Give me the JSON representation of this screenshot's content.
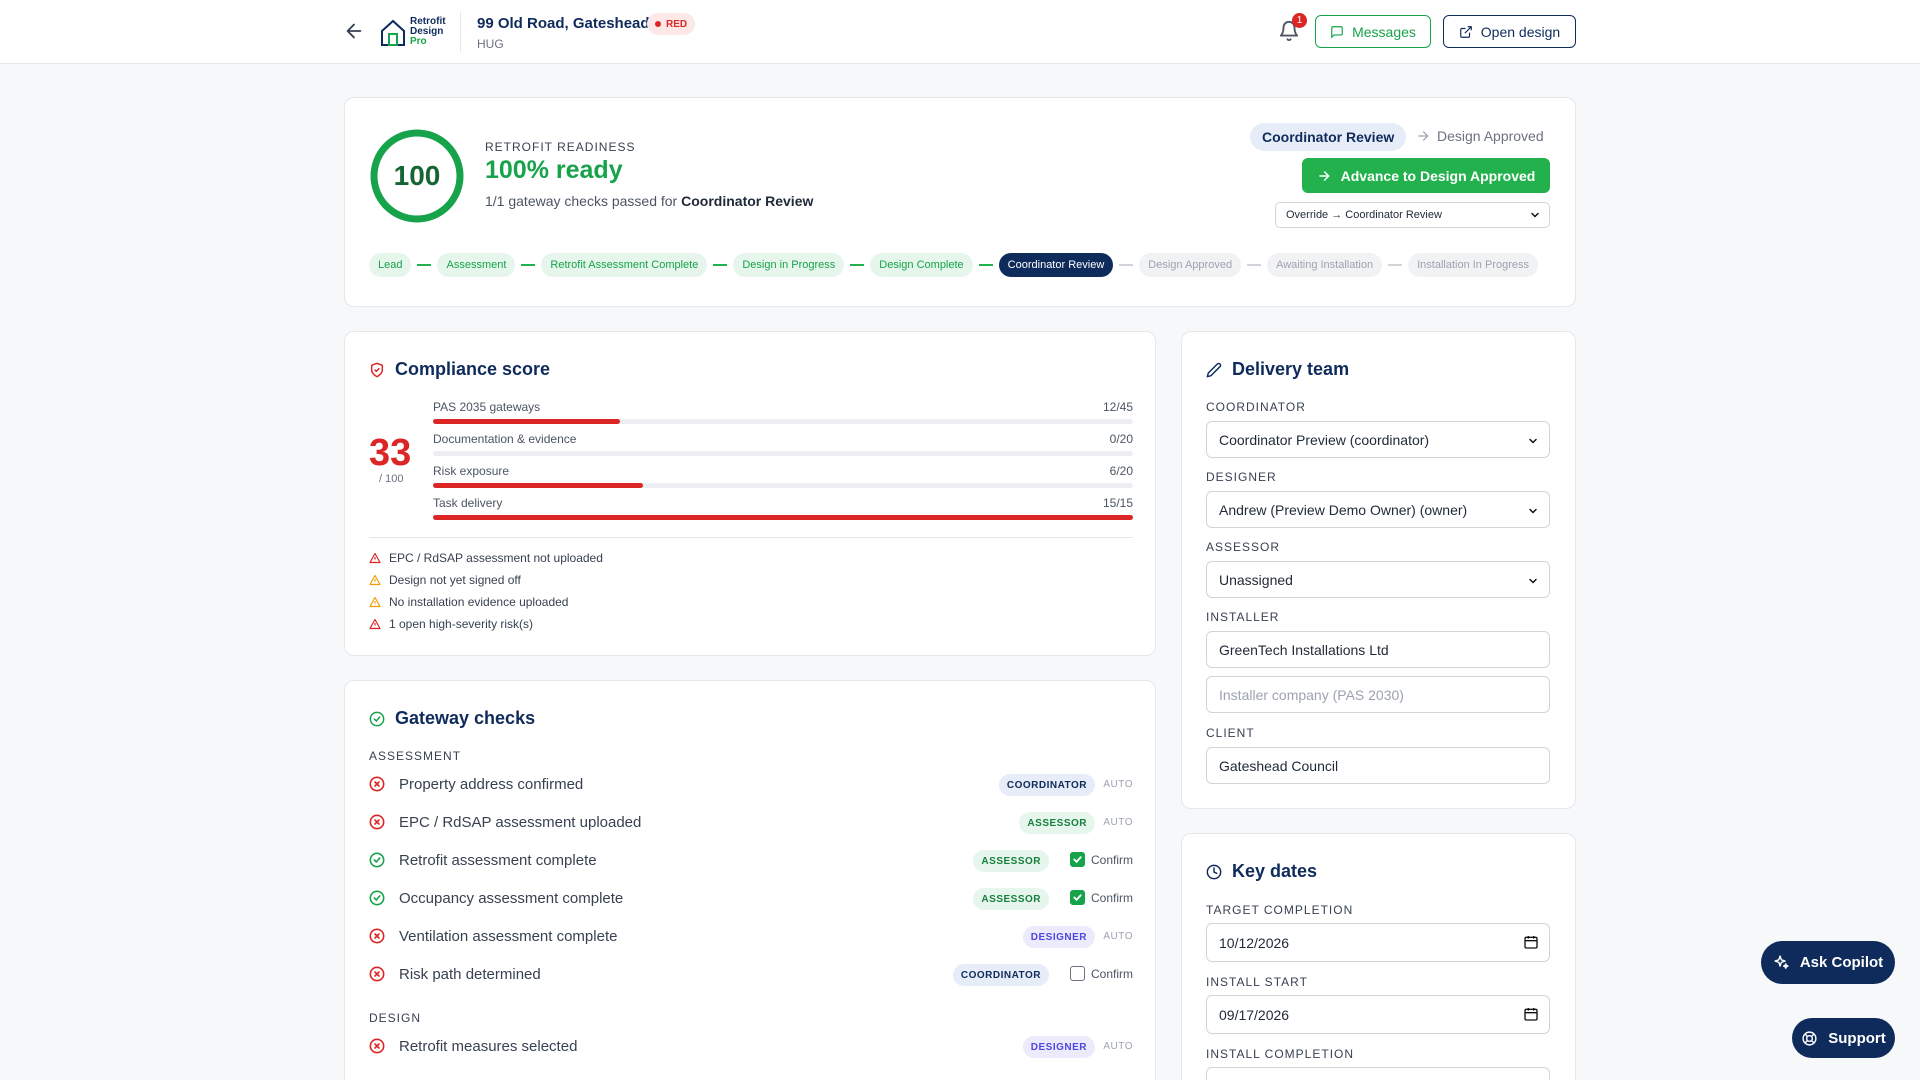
{
  "header": {
    "logo": {
      "line1": "Retrofit",
      "line2": "Design",
      "line3": "Pro"
    },
    "property_title": "99 Old Road, Gateshead",
    "property_sub": "HUG",
    "rag_label": "RED",
    "notification_count": "1",
    "messages_label": "Messages",
    "open_design_label": "Open design"
  },
  "readiness": {
    "score": "100",
    "score_fraction": 1.0,
    "eyebrow": "RETROFIT READINESS",
    "title": "100% ready",
    "sub_prefix": "1/1 gateway checks passed for",
    "sub_stage": "Coordinator Review",
    "current_stage": "Coordinator Review",
    "next_stage": "Design Approved",
    "advance_label": "Advance to Design Approved",
    "override_value": "Override → Coordinator Review",
    "pipeline": [
      {
        "label": "Lead",
        "state": "done"
      },
      {
        "label": "Assessment",
        "state": "done"
      },
      {
        "label": "Retrofit Assessment Complete",
        "state": "done"
      },
      {
        "label": "Design in Progress",
        "state": "done"
      },
      {
        "label": "Design Complete",
        "state": "done"
      },
      {
        "label": "Coordinator Review",
        "state": "current"
      },
      {
        "label": "Design Approved",
        "state": "future"
      },
      {
        "label": "Awaiting Installation",
        "state": "future"
      },
      {
        "label": "Installation In Progress",
        "state": "future"
      }
    ]
  },
  "compliance": {
    "title": "Compliance score",
    "score": "33",
    "denominator": "/ 100",
    "metrics": [
      {
        "label": "PAS 2035 gateways",
        "value": "12/45",
        "fraction": 0.267
      },
      {
        "label": "Documentation & evidence",
        "value": "0/20",
        "fraction": 0
      },
      {
        "label": "Risk exposure",
        "value": "6/20",
        "fraction": 0.3
      },
      {
        "label": "Task delivery",
        "value": "15/15",
        "fraction": 1.0
      }
    ],
    "issues": [
      {
        "text": "EPC / RdSAP assessment not uploaded",
        "severity": "high"
      },
      {
        "text": "Design not yet signed off",
        "severity": "medium"
      },
      {
        "text": "No installation evidence uploaded",
        "severity": "medium"
      },
      {
        "text": "1 open high-severity risk(s)",
        "severity": "high"
      }
    ]
  },
  "gateway": {
    "title": "Gateway checks",
    "sections": [
      {
        "label": "ASSESSMENT",
        "checks": [
          {
            "label": "Property address confirmed",
            "status": "fail",
            "role": "COORDINATOR",
            "mode": "AUTO"
          },
          {
            "label": "EPC / RdSAP assessment uploaded",
            "status": "fail",
            "role": "ASSESSOR",
            "mode": "AUTO"
          },
          {
            "label": "Retrofit assessment complete",
            "status": "pass",
            "role": "ASSESSOR",
            "mode": "Confirm",
            "checked": true
          },
          {
            "label": "Occupancy assessment complete",
            "status": "pass",
            "role": "ASSESSOR",
            "mode": "Confirm",
            "checked": true
          },
          {
            "label": "Ventilation assessment complete",
            "status": "fail",
            "role": "DESIGNER",
            "mode": "AUTO"
          },
          {
            "label": "Risk path determined",
            "status": "fail",
            "role": "COORDINATOR",
            "mode": "Confirm",
            "checked": false
          }
        ]
      },
      {
        "label": "DESIGN",
        "checks": [
          {
            "label": "Retrofit measures selected",
            "status": "fail",
            "role": "DESIGNER",
            "mode": "AUTO"
          }
        ]
      }
    ]
  },
  "team": {
    "title": "Delivery team",
    "coordinator_label": "COORDINATOR",
    "coordinator_value": "Coordinator Preview (coordinator)",
    "designer_label": "DESIGNER",
    "designer_value": "Andrew (Preview Demo Owner) (owner)",
    "assessor_label": "ASSESSOR",
    "assessor_value": "Unassigned",
    "installer_label": "INSTALLER",
    "installer_value": "GreenTech Installations Ltd",
    "installer_company_placeholder": "Installer company (PAS 2030)",
    "client_label": "CLIENT",
    "client_value": "Gateshead Council"
  },
  "dates": {
    "title": "Key dates",
    "target_label": "TARGET COMPLETION",
    "target_value": "10/12/2026",
    "install_start_label": "INSTALL START",
    "install_start_value": "09/17/2026",
    "install_completion_label": "INSTALL COMPLETION"
  },
  "floating": {
    "copilot_label": "Ask Copilot",
    "support_label": "Support"
  },
  "colors": {
    "navy": "#0f2b5b",
    "green": "#16a34a",
    "red": "#dc2626",
    "amber": "#f59e0b"
  }
}
